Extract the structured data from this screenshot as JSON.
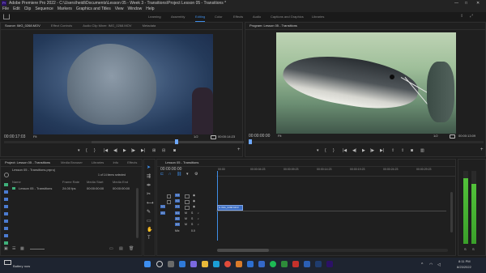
{
  "app": {
    "title": "Adobe Premiere Pro 2022 - C:\\Users\\heidi\\Documents\\Lesson 05 - Week 3 - Transitions\\Project Lesson 05 - Transitions *",
    "window_controls": [
      "—",
      "□",
      "✕"
    ]
  },
  "menu": [
    "File",
    "Edit",
    "Clip",
    "Sequence",
    "Markers",
    "Graphics and Titles",
    "View",
    "Window",
    "Help"
  ],
  "workspaces": [
    "Learning",
    "Assembly",
    "Editing",
    "Color",
    "Effects",
    "Audio",
    "Captions and Graphics",
    "Libraries"
  ],
  "workspaces_active": "Editing",
  "source": {
    "tabs": [
      "Source: IMG_0268.MOV",
      "Effect Controls",
      "Audio Clip Mixer: IMG_0268.MOV",
      "Metadata"
    ],
    "timecode_left": "00:00:17:03",
    "timecode_right": "00:00:14:23",
    "fit": "Fit",
    "resolution": "1/2"
  },
  "program": {
    "tabs": [
      "Program: Lesson 05 - Transitions"
    ],
    "timecode_left": "00:00:00:00",
    "timecode_right": "00:00:13:09",
    "fit": "Fit",
    "resolution": "1/2"
  },
  "project": {
    "tabs": [
      "Project: Lesson 05 - Transitions",
      "Media Browser",
      "Libraries",
      "Info",
      "Effects"
    ],
    "breadcrumb": "Lesson 05 - Transitions.prproj",
    "item_count": "1 of 14 items selected",
    "columns": [
      "Name",
      "Frame Rate",
      "Media Start",
      "Media End"
    ],
    "rows": [
      {
        "name": "Lesson 05 - Transitions",
        "rate": "24.00 fps",
        "start": "00:00:00:00",
        "end": "00:00:00:00"
      }
    ]
  },
  "timeline": {
    "tab": "Lesson 05 - Transitions",
    "timecode": "00:00:00:00",
    "ruler": [
      "00:00",
      "00:00:04:23",
      "00:00:09:23",
      "00:00:14:23",
      "00:00:19:23",
      "00:00:24:23",
      "00:00:29:23"
    ],
    "video_tracks": [
      "V3",
      "V2",
      "V1"
    ],
    "audio_tracks": [
      "A1",
      "A2",
      "A3"
    ],
    "mix_label": "Mix",
    "mix_value": "0.0",
    "clip_label": "IMG_0268.MOV"
  },
  "meter": {
    "labels": [
      "S",
      "S"
    ]
  },
  "status": {
    "text": "Battery now"
  },
  "tray": {
    "time": "8:11 PM",
    "date": "8/23/2022"
  },
  "colors": {
    "accent": "#3f8ee8",
    "label_green": "#3fb07a",
    "clip_blue": "#3c6dc2",
    "bg": "#1d1d1d"
  }
}
